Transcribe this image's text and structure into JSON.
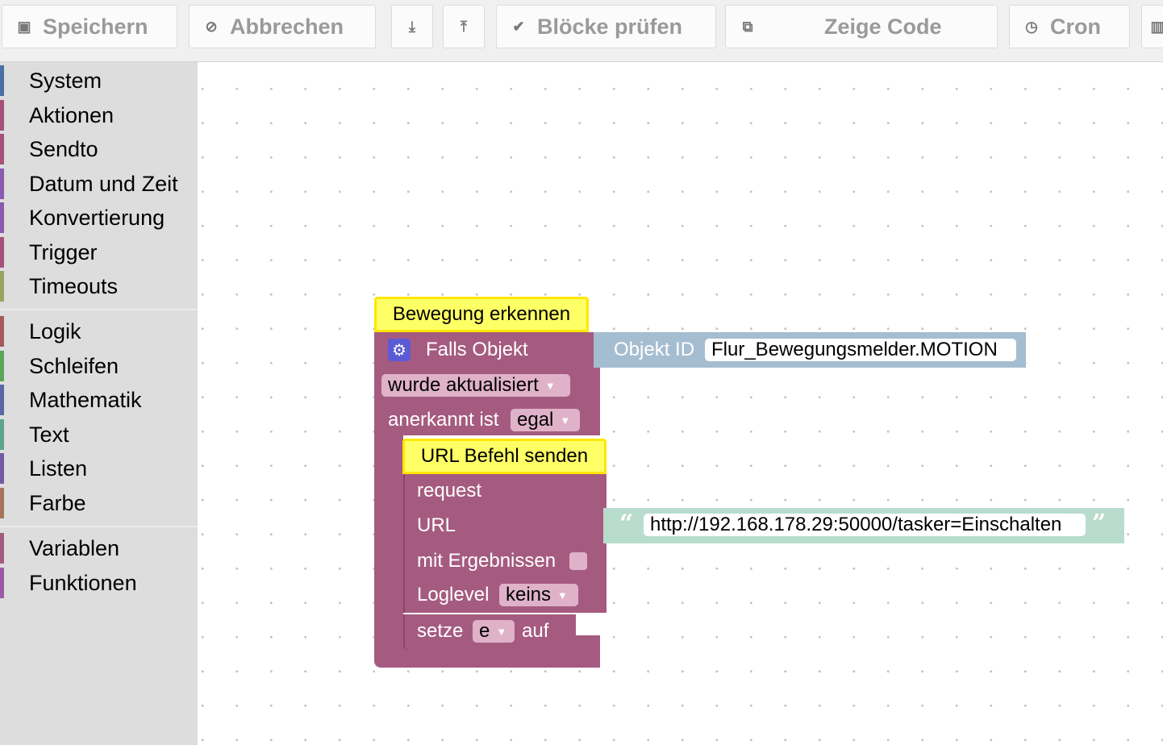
{
  "toolbar": {
    "save_label": "Speichern",
    "cancel_label": "Abbrechen",
    "check_label": "Blöcke prüfen",
    "code_label": "Zeige Code",
    "cron_label": "Cron",
    "icons": {
      "save": "save-icon",
      "cancel": "cancel-icon",
      "export": "download-icon",
      "import": "upload-icon",
      "check": "checkmark-icon",
      "code": "code-icon",
      "cron": "clock-icon"
    }
  },
  "sidebar": {
    "groups": [
      [
        {
          "label": "System",
          "color": "#4a6fa5"
        },
        {
          "label": "Aktionen",
          "color": "#a5517a"
        },
        {
          "label": "Sendto",
          "color": "#a5517a"
        },
        {
          "label": "Datum und Zeit",
          "color": "#8a5bb0"
        },
        {
          "label": "Konvertierung",
          "color": "#8a5bb0"
        },
        {
          "label": "Trigger",
          "color": "#a5517a"
        },
        {
          "label": "Timeouts",
          "color": "#9aa35b"
        }
      ],
      [
        {
          "label": "Logik",
          "color": "#a55b5b"
        },
        {
          "label": "Schleifen",
          "color": "#5ba55b"
        },
        {
          "label": "Mathematik",
          "color": "#5b67a5"
        },
        {
          "label": "Text",
          "color": "#5ba58c"
        },
        {
          "label": "Listen",
          "color": "#745ba5"
        },
        {
          "label": "Farbe",
          "color": "#a5745b"
        }
      ],
      [
        {
          "label": "Variablen",
          "color": "#a55b80"
        },
        {
          "label": "Funktionen",
          "color": "#995ba5"
        }
      ]
    ]
  },
  "workspace": {
    "trigger_block": {
      "comment": "Bewegung erkennen",
      "title": "Falls Objekt",
      "event_value": "wurde aktualisiert",
      "ack_label": "anerkannt ist",
      "ack_value": "egal",
      "object_label": "Objekt ID",
      "object_id": "Flur_Bewegungsmelder.MOTION"
    },
    "request_block": {
      "comment": "URL Befehl senden",
      "title": "request",
      "url_label": "URL",
      "url_value": "http://192.168.178.29:50000/tasker=Einschalten",
      "results_label": "mit Ergebnissen",
      "loglevel_label": "Loglevel",
      "loglevel_value": "keins"
    },
    "set_block": {
      "label": "setze",
      "variable": "e",
      "to_label": "auf"
    },
    "colors": {
      "block": "#a55b80",
      "object_block": "#a5bdd0",
      "text_block": "#b8dccd",
      "comment": "#ffff66"
    }
  }
}
